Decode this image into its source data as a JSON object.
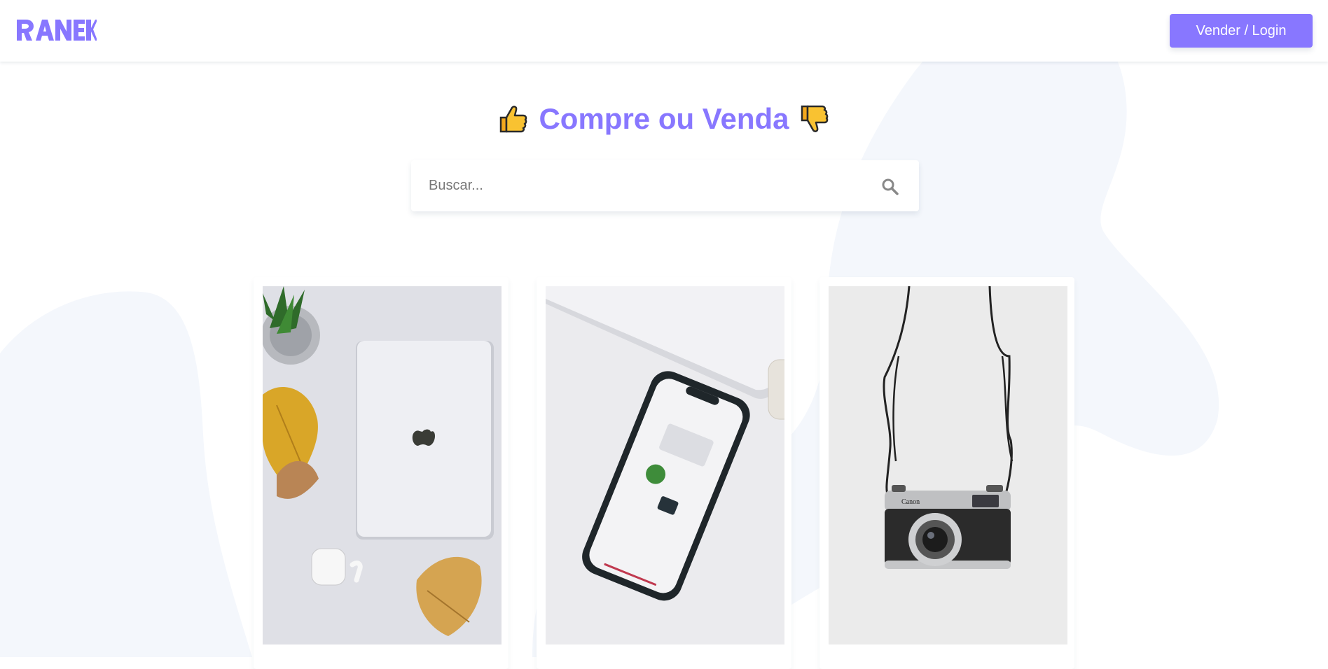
{
  "app": {
    "brand_logo": "RANEK"
  },
  "header": {
    "login_label": "Vender / Login"
  },
  "hero": {
    "title": "Compre ou Venda",
    "left_icon": "thumbs-up-icon",
    "right_icon": "thumbs-down-icon"
  },
  "search": {
    "placeholder": "Buscar...",
    "value": "",
    "icon": "search-icon"
  },
  "products": [
    {
      "image": "laptop-photo"
    },
    {
      "image": "smartphone-photo"
    },
    {
      "image": "camera-photo"
    }
  ],
  "colors": {
    "accent": "#8877ff",
    "blob": "#f4f7fc",
    "text_muted": "#777777"
  }
}
